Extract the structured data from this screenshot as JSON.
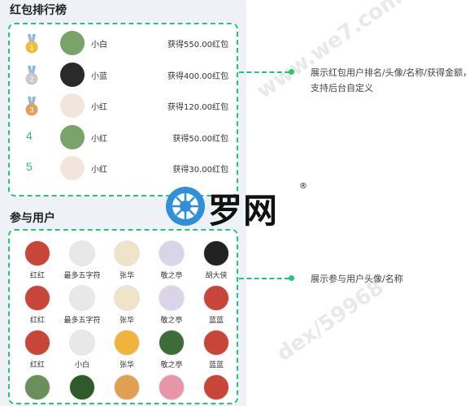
{
  "rank_section": {
    "title": "红包排行榜"
  },
  "users_section": {
    "title": "参与用户"
  },
  "rank_list": [
    {
      "badge": "1",
      "name": "小白",
      "amount": "获得550.00红包",
      "avatar_color": "#7aa36a",
      "badge_type": "medal-gold"
    },
    {
      "badge": "2",
      "name": "小蓝",
      "amount": "获得400.00红包",
      "avatar_color": "#2a2a2a",
      "badge_type": "medal-silver"
    },
    {
      "badge": "3",
      "name": "小红",
      "amount": "获得120.00红包",
      "avatar_color": "#f2e6dc",
      "badge_type": "medal-bronze"
    },
    {
      "badge": "4",
      "name": "小红",
      "amount": "获得50.00红包",
      "avatar_color": "#7aa36a",
      "badge_type": "number"
    },
    {
      "badge": "5",
      "name": "小红",
      "amount": "获得30.00红包",
      "avatar_color": "#f2e6dc",
      "badge_type": "number"
    }
  ],
  "users": [
    {
      "name": "红红",
      "avatar_color": "#c8453a"
    },
    {
      "name": "最多五字符",
      "avatar_color": "#e8e8e8"
    },
    {
      "name": "张华",
      "avatar_color": "#efe3c9"
    },
    {
      "name": "敬之亭",
      "avatar_color": "#d9d4e8"
    },
    {
      "name": "胡大侠",
      "avatar_color": "#222222"
    },
    {
      "name": "红红",
      "avatar_color": "#c8453a"
    },
    {
      "name": "最多五字符",
      "avatar_color": "#e8e8e8"
    },
    {
      "name": "张华",
      "avatar_color": "#efe3c9"
    },
    {
      "name": "敬之亭",
      "avatar_color": "#d9d4e8"
    },
    {
      "name": "蓝蓝",
      "avatar_color": "#c8453a"
    },
    {
      "name": "红红",
      "avatar_color": "#c8453a"
    },
    {
      "name": "小白",
      "avatar_color": "#e8e8e8"
    },
    {
      "name": "张华",
      "avatar_color": "#f0b43a"
    },
    {
      "name": "敬之亭",
      "avatar_color": "#3d6b3a"
    },
    {
      "name": "蓝蓝",
      "avatar_color": "#c8453a"
    },
    {
      "name": "",
      "avatar_color": "#6a8f5a"
    },
    {
      "name": "",
      "avatar_color": "#2f5a2a"
    },
    {
      "name": "",
      "avatar_color": "#e0a050"
    },
    {
      "name": "",
      "avatar_color": "#e895a8"
    },
    {
      "name": "",
      "avatar_color": "#c8453a"
    }
  ],
  "annotations": {
    "rank_desc": "展示红包用户排名/头像/名称/获得金额，支持后台自定义",
    "users_desc": "展示参与用户头像/名称"
  },
  "watermark": {
    "text": "罗网",
    "reg": "®"
  },
  "colors": {
    "accent": "#27c57a",
    "panel_bg": "#eef1f5",
    "medal_gold": "#f2b93b",
    "medal_silver": "#c9c9c9",
    "medal_bronze": "#e0a25a",
    "ribbon": "#8fb6e6"
  }
}
